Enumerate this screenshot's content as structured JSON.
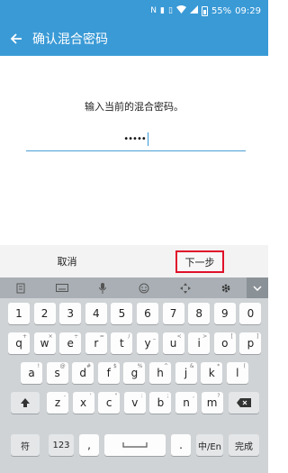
{
  "status": {
    "battery": "55%",
    "time": "09:29"
  },
  "appbar": {
    "title": "确认混合密码"
  },
  "content": {
    "prompt": "输入当前的混合密码。",
    "password_mask": "•••••"
  },
  "actions": {
    "cancel_label": "取消",
    "next_label": "下一步"
  },
  "keyboard": {
    "row_numbers": [
      "1",
      "2",
      "3",
      "4",
      "5",
      "6",
      "7",
      "8",
      "9",
      "0"
    ],
    "row_q": [
      {
        "k": "q",
        "h": "+"
      },
      {
        "k": "w",
        "h": "×"
      },
      {
        "k": "e",
        "h": "÷"
      },
      {
        "k": "r",
        "h": "="
      },
      {
        "k": "t",
        "h": "/"
      },
      {
        "k": "y",
        "h": "_"
      },
      {
        "k": "u",
        "h": "<"
      },
      {
        "k": "i",
        "h": ">"
      },
      {
        "k": "o",
        "h": "["
      },
      {
        "k": "p",
        "h": "]"
      }
    ],
    "row_a": [
      {
        "k": "a",
        "h": "!"
      },
      {
        "k": "s",
        "h": "@"
      },
      {
        "k": "d",
        "h": "#"
      },
      {
        "k": "f",
        "h": "$"
      },
      {
        "k": "g",
        "h": "%"
      },
      {
        "k": "h",
        "h": "^"
      },
      {
        "k": "j",
        "h": "&"
      },
      {
        "k": "k",
        "h": "*"
      },
      {
        "k": "l",
        "h": "("
      }
    ],
    "row_z": [
      {
        "k": "z",
        "h": "-"
      },
      {
        "k": "x",
        "h": "'"
      },
      {
        "k": "c",
        "h": "\""
      },
      {
        "k": "v",
        "h": ":"
      },
      {
        "k": "b",
        "h": ";"
      },
      {
        "k": "n",
        "h": ","
      },
      {
        "k": "m",
        "h": "?"
      }
    ],
    "symbol_key": "符",
    "num_key": "123",
    "comma_key": ",",
    "period_key": ".",
    "lang_key": "中/En",
    "done_key": "完成"
  }
}
